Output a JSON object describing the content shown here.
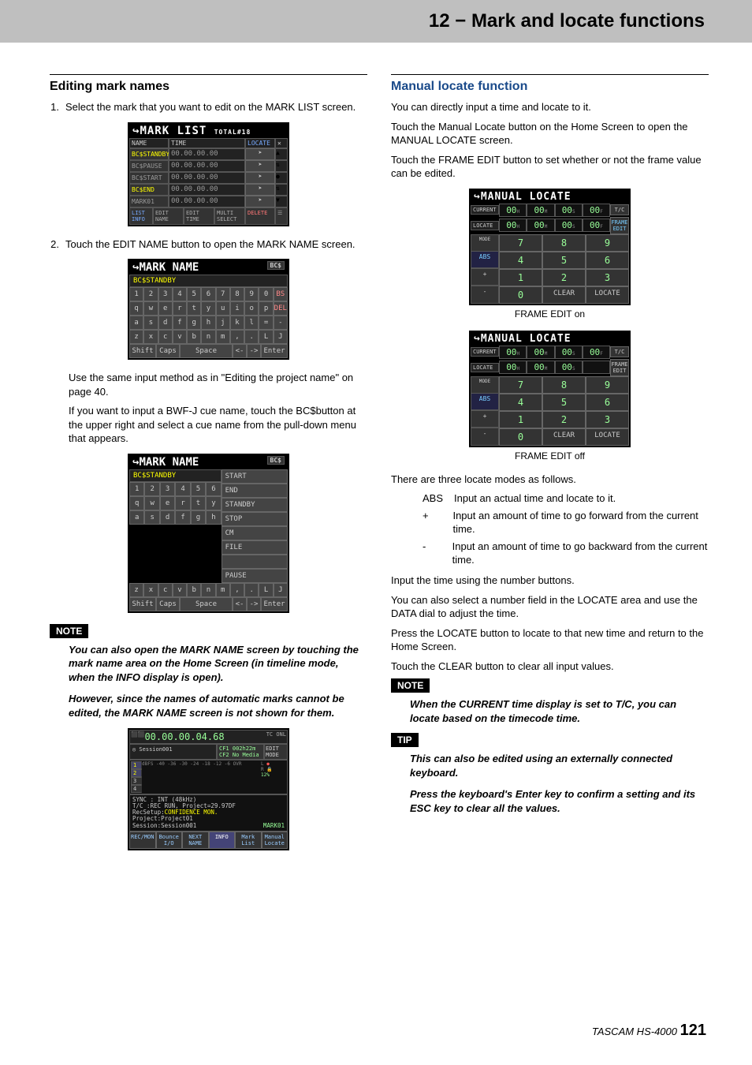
{
  "header": {
    "chapter_title": "12 − Mark and locate functions"
  },
  "left": {
    "h1": "Editing mark names",
    "step1_num": "1.",
    "step1": "Select the mark that you want to edit on the MARK LIST screen.",
    "step2_num": "2.",
    "step2": "Touch the EDIT NAME button to open the MARK NAME screen.",
    "p_same": "Use the same input method as in \"Editing the project name\" on page 40.",
    "p_bwf": "If you want to input a BWF-J cue name, touch the BC$button at the upper right and select a cue name from the pull-down menu that appears.",
    "note_label": "NOTE",
    "note1": "You can also open the MARK NAME screen by touching the mark name area on the Home Screen (in timeline mode, when the INFO display is open).",
    "note2": "However, since the names of automatic marks cannot be edited, the MARK NAME screen is not shown for them.",
    "mark_list": {
      "title": "MARK LIST",
      "total": "TOTAL#18",
      "hdr_name": "NAME",
      "hdr_time": "TIME",
      "hdr_locate": "LOCATE",
      "rows": [
        {
          "nm": "BC$STANDBY",
          "tc": "00.00.00.00",
          "gry": false
        },
        {
          "nm": "BC$PAUSE",
          "tc": "00.00.00.00",
          "gry": true
        },
        {
          "nm": "BC$START",
          "tc": "00.00.00.00",
          "gry": true
        },
        {
          "nm": "BC$END",
          "tc": "00.00.00.00",
          "gry": false
        },
        {
          "nm": "MARK01",
          "tc": "00.00.00.00",
          "gry": true
        }
      ],
      "ftr_list": "LIST INFO",
      "ftr_edit_name": "EDIT NAME",
      "ftr_edit_time": "EDIT TIME",
      "ftr_multi": "MULTI SELECT",
      "ftr_delete": "DELETE"
    },
    "mark_name": {
      "title": "MARK NAME",
      "bcs": "BC$",
      "field": "BC$STANDBY",
      "row1": [
        "1",
        "2",
        "3",
        "4",
        "5",
        "6",
        "7",
        "8",
        "9",
        "0",
        "BS"
      ],
      "row2": [
        "q",
        "w",
        "e",
        "r",
        "t",
        "y",
        "u",
        "i",
        "o",
        "p",
        "DEL"
      ],
      "row3": [
        "a",
        "s",
        "d",
        "f",
        "g",
        "h",
        "j",
        "k",
        "l",
        "=",
        "-"
      ],
      "row4": [
        "z",
        "x",
        "c",
        "v",
        "b",
        "n",
        "m",
        ",",
        ".",
        "L",
        "J"
      ],
      "shift": "Shift",
      "caps": "Caps",
      "space": "Space",
      "la": "<-",
      "ra": "->",
      "enter": "Enter",
      "cue_menu": [
        "START",
        "END",
        "STANDBY",
        "STOP",
        "CM",
        "FILE",
        "",
        "PAUSE"
      ]
    },
    "home": {
      "time": "00.00.00.04.68",
      "session": "◎ Session001",
      "cf1": "CF1  002h22m",
      "cf2": "CF2 No Media",
      "edit": "EDIT MODE",
      "slots": [
        "1",
        "2",
        "3",
        "4"
      ],
      "db": "dBFS  -40 -36  -30  -24   -18   -12   -6    OVR",
      "lv_l": "L",
      "lv_r": "R",
      "lv_lock": "🔒",
      "lv_12": "12%",
      "sync": "SYNC  : INT (48kHz)",
      "tc": "T/C   :REC RUN, Project=29.97DF",
      "recsetup": "RecSetup:",
      "recmon": "CONFIDENCE MON.",
      "project": "Project:Project01",
      "session2": "Session:Session001",
      "mark01": "MARK01",
      "btns": [
        "REC/MON",
        "Bounce I/O",
        "NEXT NAME",
        "INFO",
        "Mark List",
        "Manual Locate"
      ]
    }
  },
  "right": {
    "h1": "Manual locate function",
    "p1": "You can directly input a time and locate to it.",
    "p2": "Touch the Manual Locate button on the Home Screen to open the MANUAL LOCATE screen.",
    "p3": "Touch the FRAME EDIT button to set whether or not the frame value can be edited.",
    "cap_on": "FRAME EDIT on",
    "cap_off": "FRAME EDIT off",
    "p4": "There are three locate modes as follows.",
    "modes": [
      {
        "k": "ABS",
        "d": "Input an actual time and locate to it."
      },
      {
        "k": "+",
        "d": "Input an amount of time to go forward from the current time."
      },
      {
        "k": "-",
        "d": "Input an amount of time to go backward from the current time."
      }
    ],
    "p5": "Input the time using the number buttons.",
    "p6": "You can also select a number field in the LOCATE area and use the DATA dial to adjust the time.",
    "p7": "Press the LOCATE button to locate to that new time and return to the Home Screen.",
    "p8": "Touch the CLEAR button to clear all input values.",
    "note_label": "NOTE",
    "note1": "When the CURRENT time display is set to T/C, you can locate based on the timecode time.",
    "tip_label": "TIP",
    "tip1": "This can also be edited using an externally connected keyboard.",
    "tip2": "Press the keyboard's Enter key to confirm a setting and its ESC key to clear all the values.",
    "manloc": {
      "title": "MANUAL LOCATE",
      "cur": "CURRENT",
      "loc": "LOCATE",
      "mode": "MODE",
      "abs": "ABS",
      "tc": "T/C",
      "frame": "FRAME EDIT",
      "segs": [
        "00",
        "00",
        "00",
        "00"
      ],
      "units": [
        "H",
        "M",
        "S",
        "F"
      ],
      "keys": [
        [
          "7",
          "8",
          "9"
        ],
        [
          "4",
          "5",
          "6"
        ],
        [
          "1",
          "2",
          "3"
        ],
        [
          "0",
          "CLEAR",
          "LOCATE"
        ]
      ],
      "pm": [
        "+",
        "-"
      ]
    }
  },
  "footer": {
    "brand": "TASCAM HS-4000",
    "page": "121"
  }
}
